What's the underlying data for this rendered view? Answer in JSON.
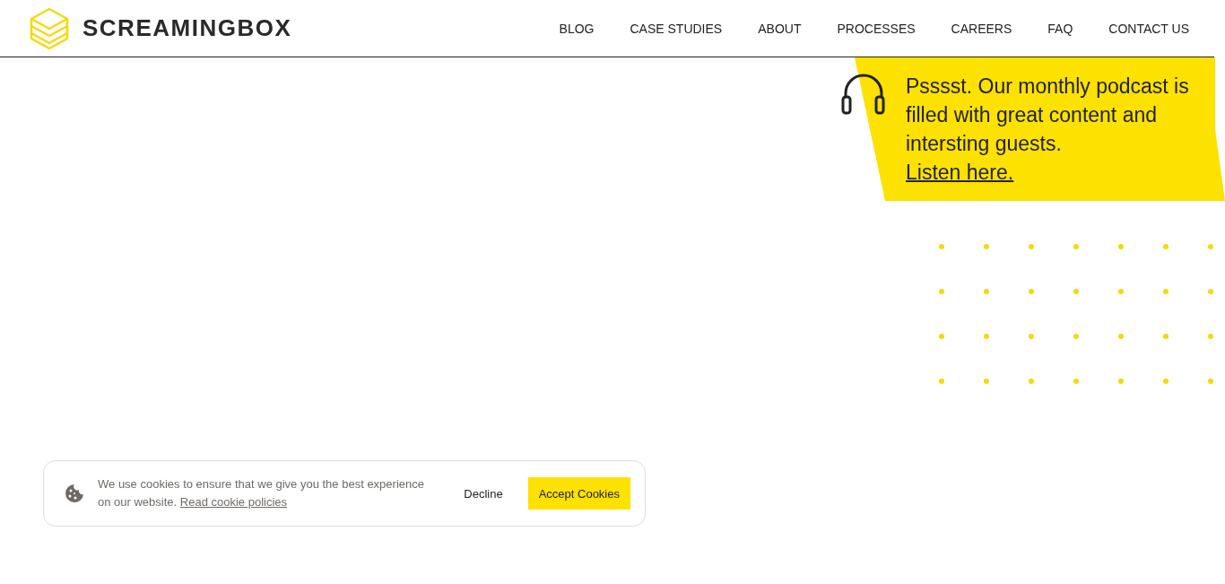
{
  "header": {
    "logo_text": "SCREAMINGBOX",
    "nav": [
      {
        "label": "BLOG"
      },
      {
        "label": "CASE STUDIES"
      },
      {
        "label": "ABOUT"
      },
      {
        "label": "PROCESSES"
      },
      {
        "label": "CAREERS"
      },
      {
        "label": "FAQ"
      },
      {
        "label": "CONTACT US"
      }
    ]
  },
  "promo": {
    "text": "Psssst. Our monthly podcast is filled with great content and intersting guests.",
    "link": "Listen here."
  },
  "cookie_banner": {
    "text": "We use cookies to ensure that we give you the best experience on our website.",
    "link": "Read cookie policies",
    "buttons": [
      {
        "label": "Decline",
        "kind": "plain"
      },
      {
        "label": "Accept Cookies",
        "kind": "primary"
      }
    ]
  }
}
